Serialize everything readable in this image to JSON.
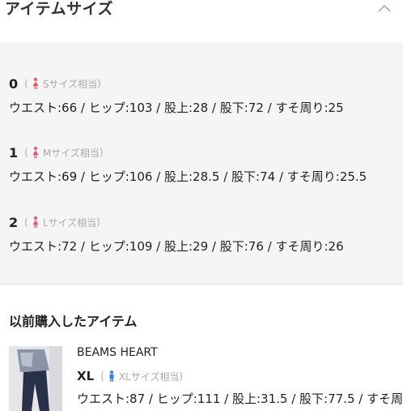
{
  "header": {
    "title": "アイテムサイズ",
    "collapse_icon": "chevron-up-icon"
  },
  "sizes": [
    {
      "name": "0",
      "fit": "Sサイズ相当",
      "measures": "ウエスト:66 / ヒップ:103 / 股上:28 / 股下:72 / すそ周り:25"
    },
    {
      "name": "1",
      "fit": "Mサイズ相当",
      "measures": "ウエスト:69 / ヒップ:106 / 股上:28.5 / 股下:74 / すそ周り:25.5"
    },
    {
      "name": "2",
      "fit": "Lサイズ相当",
      "measures": "ウエスト:72 / ヒップ:109 / 股上:29 / 股下:76 / すそ周り:26"
    }
  ],
  "paren_open": "(",
  "paren_close": ")",
  "female_icon_color": "#e0556b",
  "male_icon_color": "#3a86d6",
  "history": {
    "title": "以前購入したアイテム",
    "item": {
      "brand": "BEAMS HEART",
      "size": "XL",
      "fit": "XLサイズ相当",
      "measures": "ウエスト:87 / ヒップ:111 / 股上:31.5 / 股下:77.5 / すそ周"
    }
  }
}
